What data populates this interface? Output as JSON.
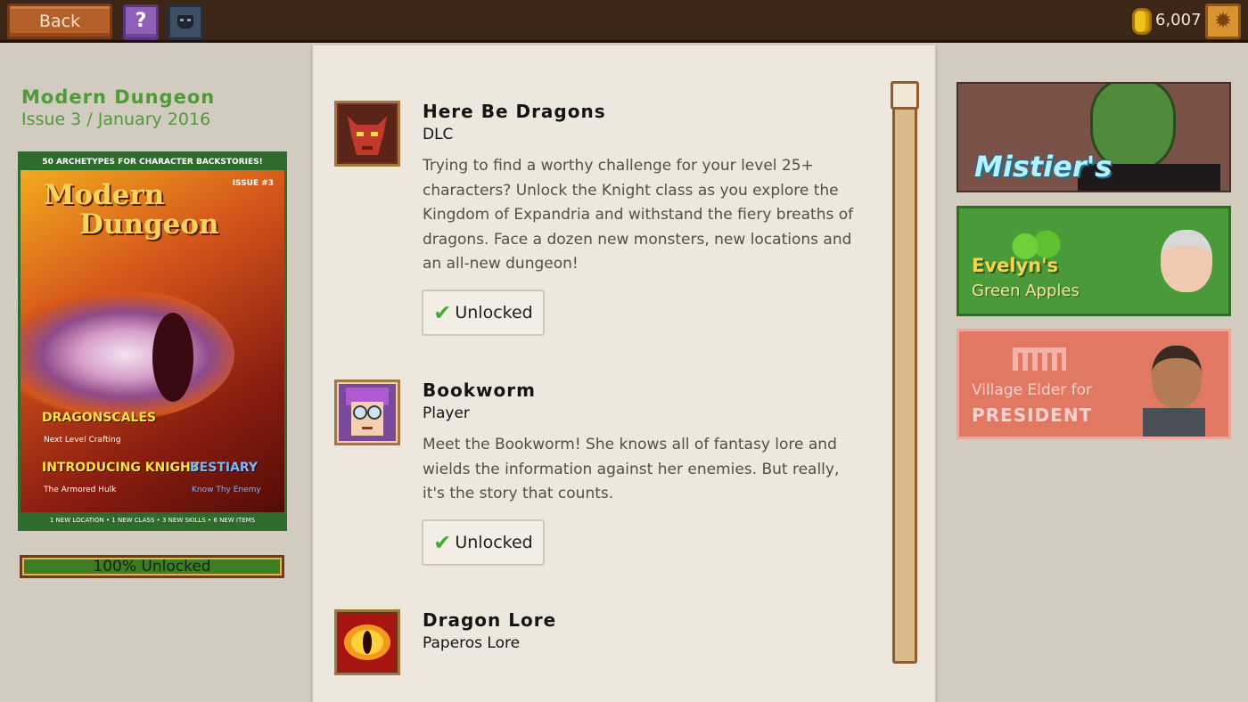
{
  "topbar": {
    "back_label": "Back",
    "help_label": "?",
    "coins": "6,007"
  },
  "left": {
    "title": "Modern  Dungeon",
    "subtitle": "Issue 3 / January 2016",
    "magazine": {
      "banner_top": "50 ARCHETYPES FOR CHARACTER BACKSTORIES!",
      "title_line1": "Modern",
      "title_line2": "Dungeon",
      "issue": "ISSUE #3",
      "feature1": "DRAGONSCALES",
      "feature1_sub": "Next Level Crafting",
      "feature2": "INTRODUCING KNIGHT",
      "feature2_sub": "The Armored Hulk",
      "feature3": "BESTIARY",
      "feature3_sub": "Know Thy Enemy",
      "banner_bottom": "1 NEW LOCATION • 1 NEW CLASS • 3 NEW SKILLS • 6 NEW ITEMS"
    },
    "progress_label": "100% Unlocked",
    "progress_value": 1.0
  },
  "entries": [
    {
      "title": "Here  Be  Dragons",
      "type": "DLC",
      "description": "Trying to find a worthy challenge for your level 25+ characters? Unlock the Knight class as you explore the Kingdom of Expandria and withstand the fiery breaths of dragons. Face a dozen new monsters, new locations and an all-new dungeon!",
      "status": "Unlocked",
      "icon": "dragon-head-icon"
    },
    {
      "title": "Bookworm",
      "type": "Player",
      "description": "Meet the Bookworm! She knows all of fantasy lore and wields the information against her enemies. But really, it's the story that counts.",
      "status": "Unlocked",
      "icon": "bookworm-portrait-icon"
    },
    {
      "title": "Dragon  Lore",
      "type": "Paperos Lore",
      "icon": "dragon-eye-icon"
    }
  ],
  "ads": {
    "mistiers": "Mistier's",
    "evelyn_title": "Evelyn's",
    "evelyn_sub": "Green Apples",
    "elder_line1": "Village Elder for",
    "elder_line2": "PRESIDENT"
  },
  "colors": {
    "topbar": "#3b2617",
    "accent_green": "#4f9a39",
    "back_button": "#b5602a"
  }
}
